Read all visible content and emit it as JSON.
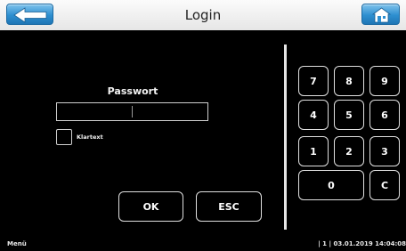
{
  "header": {
    "title": "Login",
    "back_icon": "arrow-left-icon",
    "home_icon": "home-icon",
    "accent": "#2e8fd0"
  },
  "login": {
    "password_label": "Passwort",
    "password_value": "",
    "cleartext_label": "Klartext",
    "cleartext_checked": false,
    "ok_label": "OK",
    "esc_label": "ESC"
  },
  "keypad": {
    "keys": [
      "7",
      "8",
      "9",
      "4",
      "5",
      "6",
      "1",
      "2",
      "3",
      "0",
      "C"
    ]
  },
  "footer": {
    "menu_label": "Menü",
    "status": "| 1 | 03.01.2019 14:04:08"
  }
}
